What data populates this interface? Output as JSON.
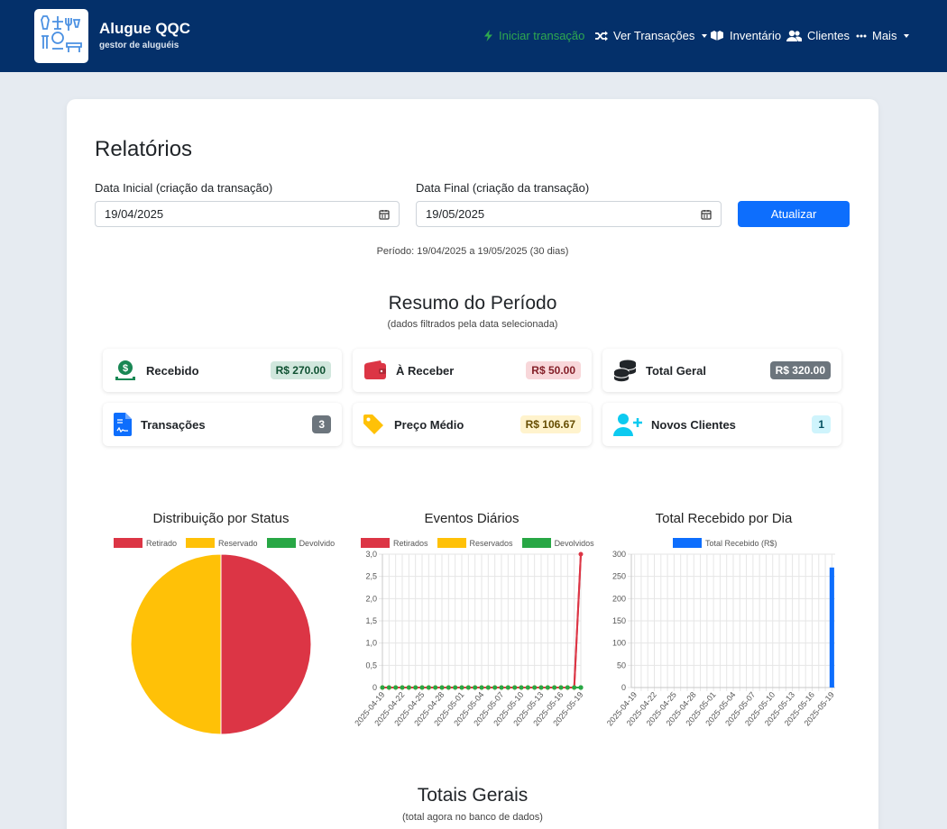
{
  "app": {
    "title": "Alugue QQC",
    "subtitle": "gestor de aluguéis"
  },
  "nav": {
    "start": "Iniciar transação",
    "transactions": "Ver Transações",
    "inventory": "Inventário",
    "clients": "Clientes",
    "more": "Mais"
  },
  "page": {
    "title": "Relatórios"
  },
  "filters": {
    "start_label": "Data Inicial (criação da transação)",
    "start_value": "19/04/2025",
    "end_label": "Data Final (criação da transação)",
    "end_value": "19/05/2025",
    "update_button": "Atualizar",
    "period": "Período: 19/04/2025 a 19/05/2025 (30 dias)"
  },
  "summary": {
    "title": "Resumo do Período",
    "subtitle": "(dados filtrados pela data selecionada)",
    "stats": [
      {
        "label": "Recebido",
        "value": "R$ 270.00",
        "icon": "money-hand-icon",
        "badge_bg": "#d1e7dd",
        "badge_fg": "#0f5132"
      },
      {
        "label": "À Receber",
        "value": "R$ 50.00",
        "icon": "wallet-icon",
        "badge_bg": "#f8d7da",
        "badge_fg": "#842029"
      },
      {
        "label": "Total Geral",
        "value": "R$ 320.00",
        "icon": "coins-icon",
        "badge_bg": "#6c757d",
        "badge_fg": "#ffffff"
      },
      {
        "label": "Transações",
        "value": "3",
        "icon": "file-contract-icon",
        "badge_bg": "#6c757d",
        "badge_fg": "#ffffff"
      },
      {
        "label": "Preço Médio",
        "value": "R$ 106.67",
        "icon": "tag-icon",
        "badge_bg": "#fff3cd",
        "badge_fg": "#664d03"
      },
      {
        "label": "Novos Clientes",
        "value": "1",
        "icon": "user-plus-icon",
        "badge_bg": "#cff4fc",
        "badge_fg": "#055160"
      }
    ]
  },
  "chart_data": [
    {
      "type": "pie",
      "title": "Distribuição por Status",
      "categories": [
        "Retirado",
        "Reservado",
        "Devolvido"
      ],
      "values": [
        1,
        1,
        0
      ],
      "colors": [
        "#dc3545",
        "#ffc107",
        "#28a745"
      ],
      "legend": "top"
    },
    {
      "type": "line",
      "title": "Eventos Diários",
      "x": [
        "2025-04-19",
        "2025-04-20",
        "2025-04-21",
        "2025-04-22",
        "2025-04-23",
        "2025-04-24",
        "2025-04-25",
        "2025-04-26",
        "2025-04-27",
        "2025-04-28",
        "2025-04-29",
        "2025-04-30",
        "2025-05-01",
        "2025-05-02",
        "2025-05-03",
        "2025-05-04",
        "2025-05-05",
        "2025-05-06",
        "2025-05-07",
        "2025-05-08",
        "2025-05-09",
        "2025-05-10",
        "2025-05-11",
        "2025-05-12",
        "2025-05-13",
        "2025-05-14",
        "2025-05-15",
        "2025-05-16",
        "2025-05-17",
        "2025-05-18",
        "2025-05-19"
      ],
      "x_ticks": [
        "2025-04-19",
        "2025-04-22",
        "2025-04-25",
        "2025-04-28",
        "2025-05-01",
        "2025-05-04",
        "2025-05-07",
        "2025-05-10",
        "2025-05-13",
        "2025-05-16",
        "2025-05-19"
      ],
      "series": [
        {
          "name": "Retirados",
          "color": "#dc3545",
          "values": [
            0,
            0,
            0,
            0,
            0,
            0,
            0,
            0,
            0,
            0,
            0,
            0,
            0,
            0,
            0,
            0,
            0,
            0,
            0,
            0,
            0,
            0,
            0,
            0,
            0,
            0,
            0,
            0,
            0,
            0,
            3
          ]
        },
        {
          "name": "Reservados",
          "color": "#ffc107",
          "values": [
            0,
            0,
            0,
            0,
            0,
            0,
            0,
            0,
            0,
            0,
            0,
            0,
            0,
            0,
            0,
            0,
            0,
            0,
            0,
            0,
            0,
            0,
            0,
            0,
            0,
            0,
            0,
            0,
            0,
            0,
            0
          ]
        },
        {
          "name": "Devolvidos",
          "color": "#28a745",
          "values": [
            0,
            0,
            0,
            0,
            0,
            0,
            0,
            0,
            0,
            0,
            0,
            0,
            0,
            0,
            0,
            0,
            0,
            0,
            0,
            0,
            0,
            0,
            0,
            0,
            0,
            0,
            0,
            0,
            0,
            0,
            0
          ]
        }
      ],
      "y_ticks": [
        "0",
        "0,5",
        "1,0",
        "1,5",
        "2,0",
        "2,5",
        "3,0"
      ],
      "ylim": [
        0,
        3
      ],
      "grid": true,
      "legend": "top"
    },
    {
      "type": "bar",
      "title": "Total Recebido por Dia",
      "x_ticks": [
        "2025-04-19",
        "2025-04-22",
        "2025-04-25",
        "2025-04-28",
        "2025-05-01",
        "2025-05-04",
        "2025-05-07",
        "2025-05-10",
        "2025-05-13",
        "2025-05-16",
        "2025-05-19"
      ],
      "categories": [
        "2025-04-19",
        "2025-04-20",
        "2025-04-21",
        "2025-04-22",
        "2025-04-23",
        "2025-04-24",
        "2025-04-25",
        "2025-04-26",
        "2025-04-27",
        "2025-04-28",
        "2025-04-29",
        "2025-04-30",
        "2025-05-01",
        "2025-05-02",
        "2025-05-03",
        "2025-05-04",
        "2025-05-05",
        "2025-05-06",
        "2025-05-07",
        "2025-05-08",
        "2025-05-09",
        "2025-05-10",
        "2025-05-11",
        "2025-05-12",
        "2025-05-13",
        "2025-05-14",
        "2025-05-15",
        "2025-05-16",
        "2025-05-17",
        "2025-05-18",
        "2025-05-19"
      ],
      "series": [
        {
          "name": "Total Recebido (R$)",
          "color": "#0d6efd",
          "values": [
            0,
            0,
            0,
            0,
            0,
            0,
            0,
            0,
            0,
            0,
            0,
            0,
            0,
            0,
            0,
            0,
            0,
            0,
            0,
            0,
            0,
            0,
            0,
            0,
            0,
            0,
            0,
            0,
            0,
            0,
            270
          ]
        }
      ],
      "y_ticks": [
        "0",
        "50",
        "100",
        "150",
        "200",
        "250",
        "300"
      ],
      "ylim": [
        0,
        300
      ],
      "grid": true,
      "legend": "top"
    }
  ],
  "totals": {
    "title": "Totais Gerais",
    "subtitle": "(total agora no banco de dados)"
  }
}
